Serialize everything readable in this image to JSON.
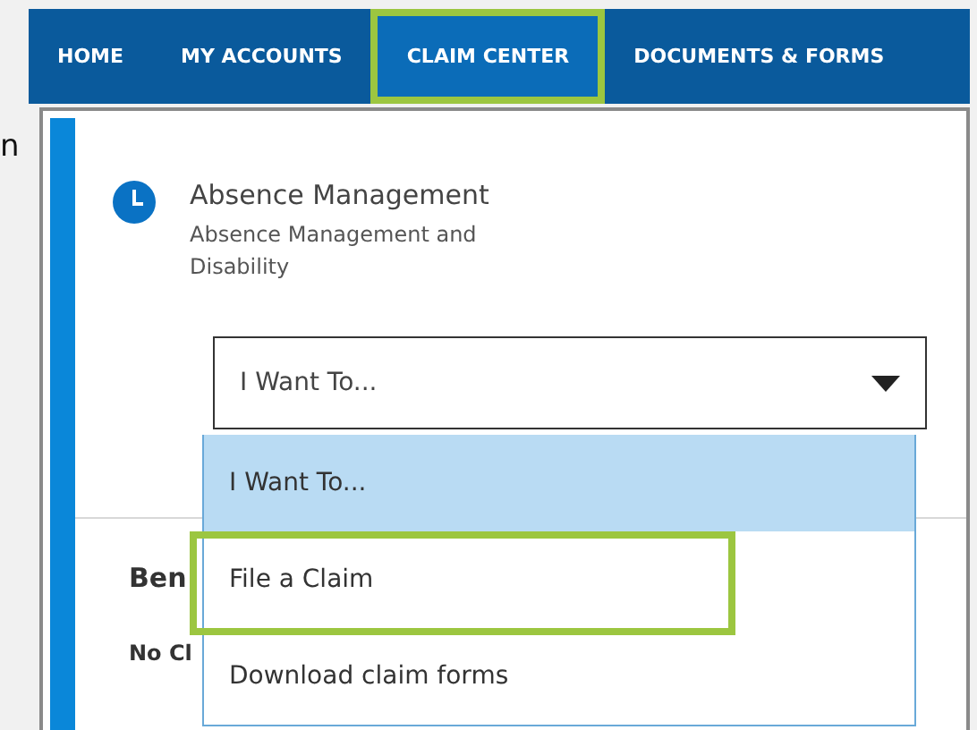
{
  "edge_text": "n",
  "nav": {
    "tabs": [
      {
        "label": "HOME",
        "selected": false,
        "highlighted": false
      },
      {
        "label": "MY ACCOUNTS",
        "selected": false,
        "highlighted": false
      },
      {
        "label": "CLAIM CENTER",
        "selected": true,
        "highlighted": true
      },
      {
        "label": "DOCUMENTS & FORMS",
        "selected": false,
        "highlighted": false
      }
    ]
  },
  "card": {
    "title": "Absence Management",
    "subtitle": "Absence Management and Disability",
    "select": {
      "value": "I Want To...",
      "expanded": true,
      "options": [
        {
          "label": "I Want To...",
          "selected": true,
          "highlighted": false
        },
        {
          "label": "File a Claim",
          "selected": false,
          "highlighted": true
        },
        {
          "label": "Download claim forms",
          "selected": false,
          "highlighted": false
        }
      ]
    },
    "section_title": "Ben",
    "section_text": "No Cl"
  }
}
